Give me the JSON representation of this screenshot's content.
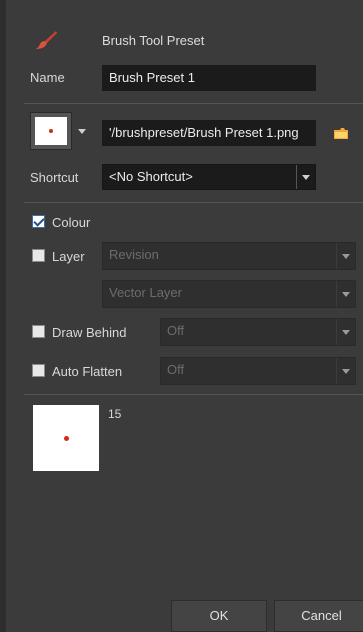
{
  "title": "Brush Tool Preset",
  "icons": {
    "title": "brush-icon",
    "folder": "folder-icon",
    "dropdown": "chevron-down-icon"
  },
  "name": {
    "label": "Name",
    "value": "Brush Preset 1"
  },
  "icon_path": {
    "value": "'/brushpreset/Brush Preset 1.png"
  },
  "shortcut": {
    "label": "Shortcut",
    "value": "<No Shortcut>"
  },
  "colour": {
    "label": "Colour",
    "checked": true
  },
  "layer": {
    "label": "Layer",
    "checked": false,
    "option1": "Revision",
    "option2": "Vector Layer"
  },
  "draw_behind": {
    "label": "Draw Behind",
    "checked": false,
    "value": "Off"
  },
  "auto_flatten": {
    "label": "Auto Flatten",
    "checked": false,
    "value": "Off"
  },
  "preview": {
    "size": "15"
  },
  "buttons": {
    "ok": "OK",
    "cancel": "Cancel"
  },
  "colors": {
    "brush_dot": "#d42a1a",
    "background": "#3b3b3b",
    "field": "#1b1b1b"
  }
}
